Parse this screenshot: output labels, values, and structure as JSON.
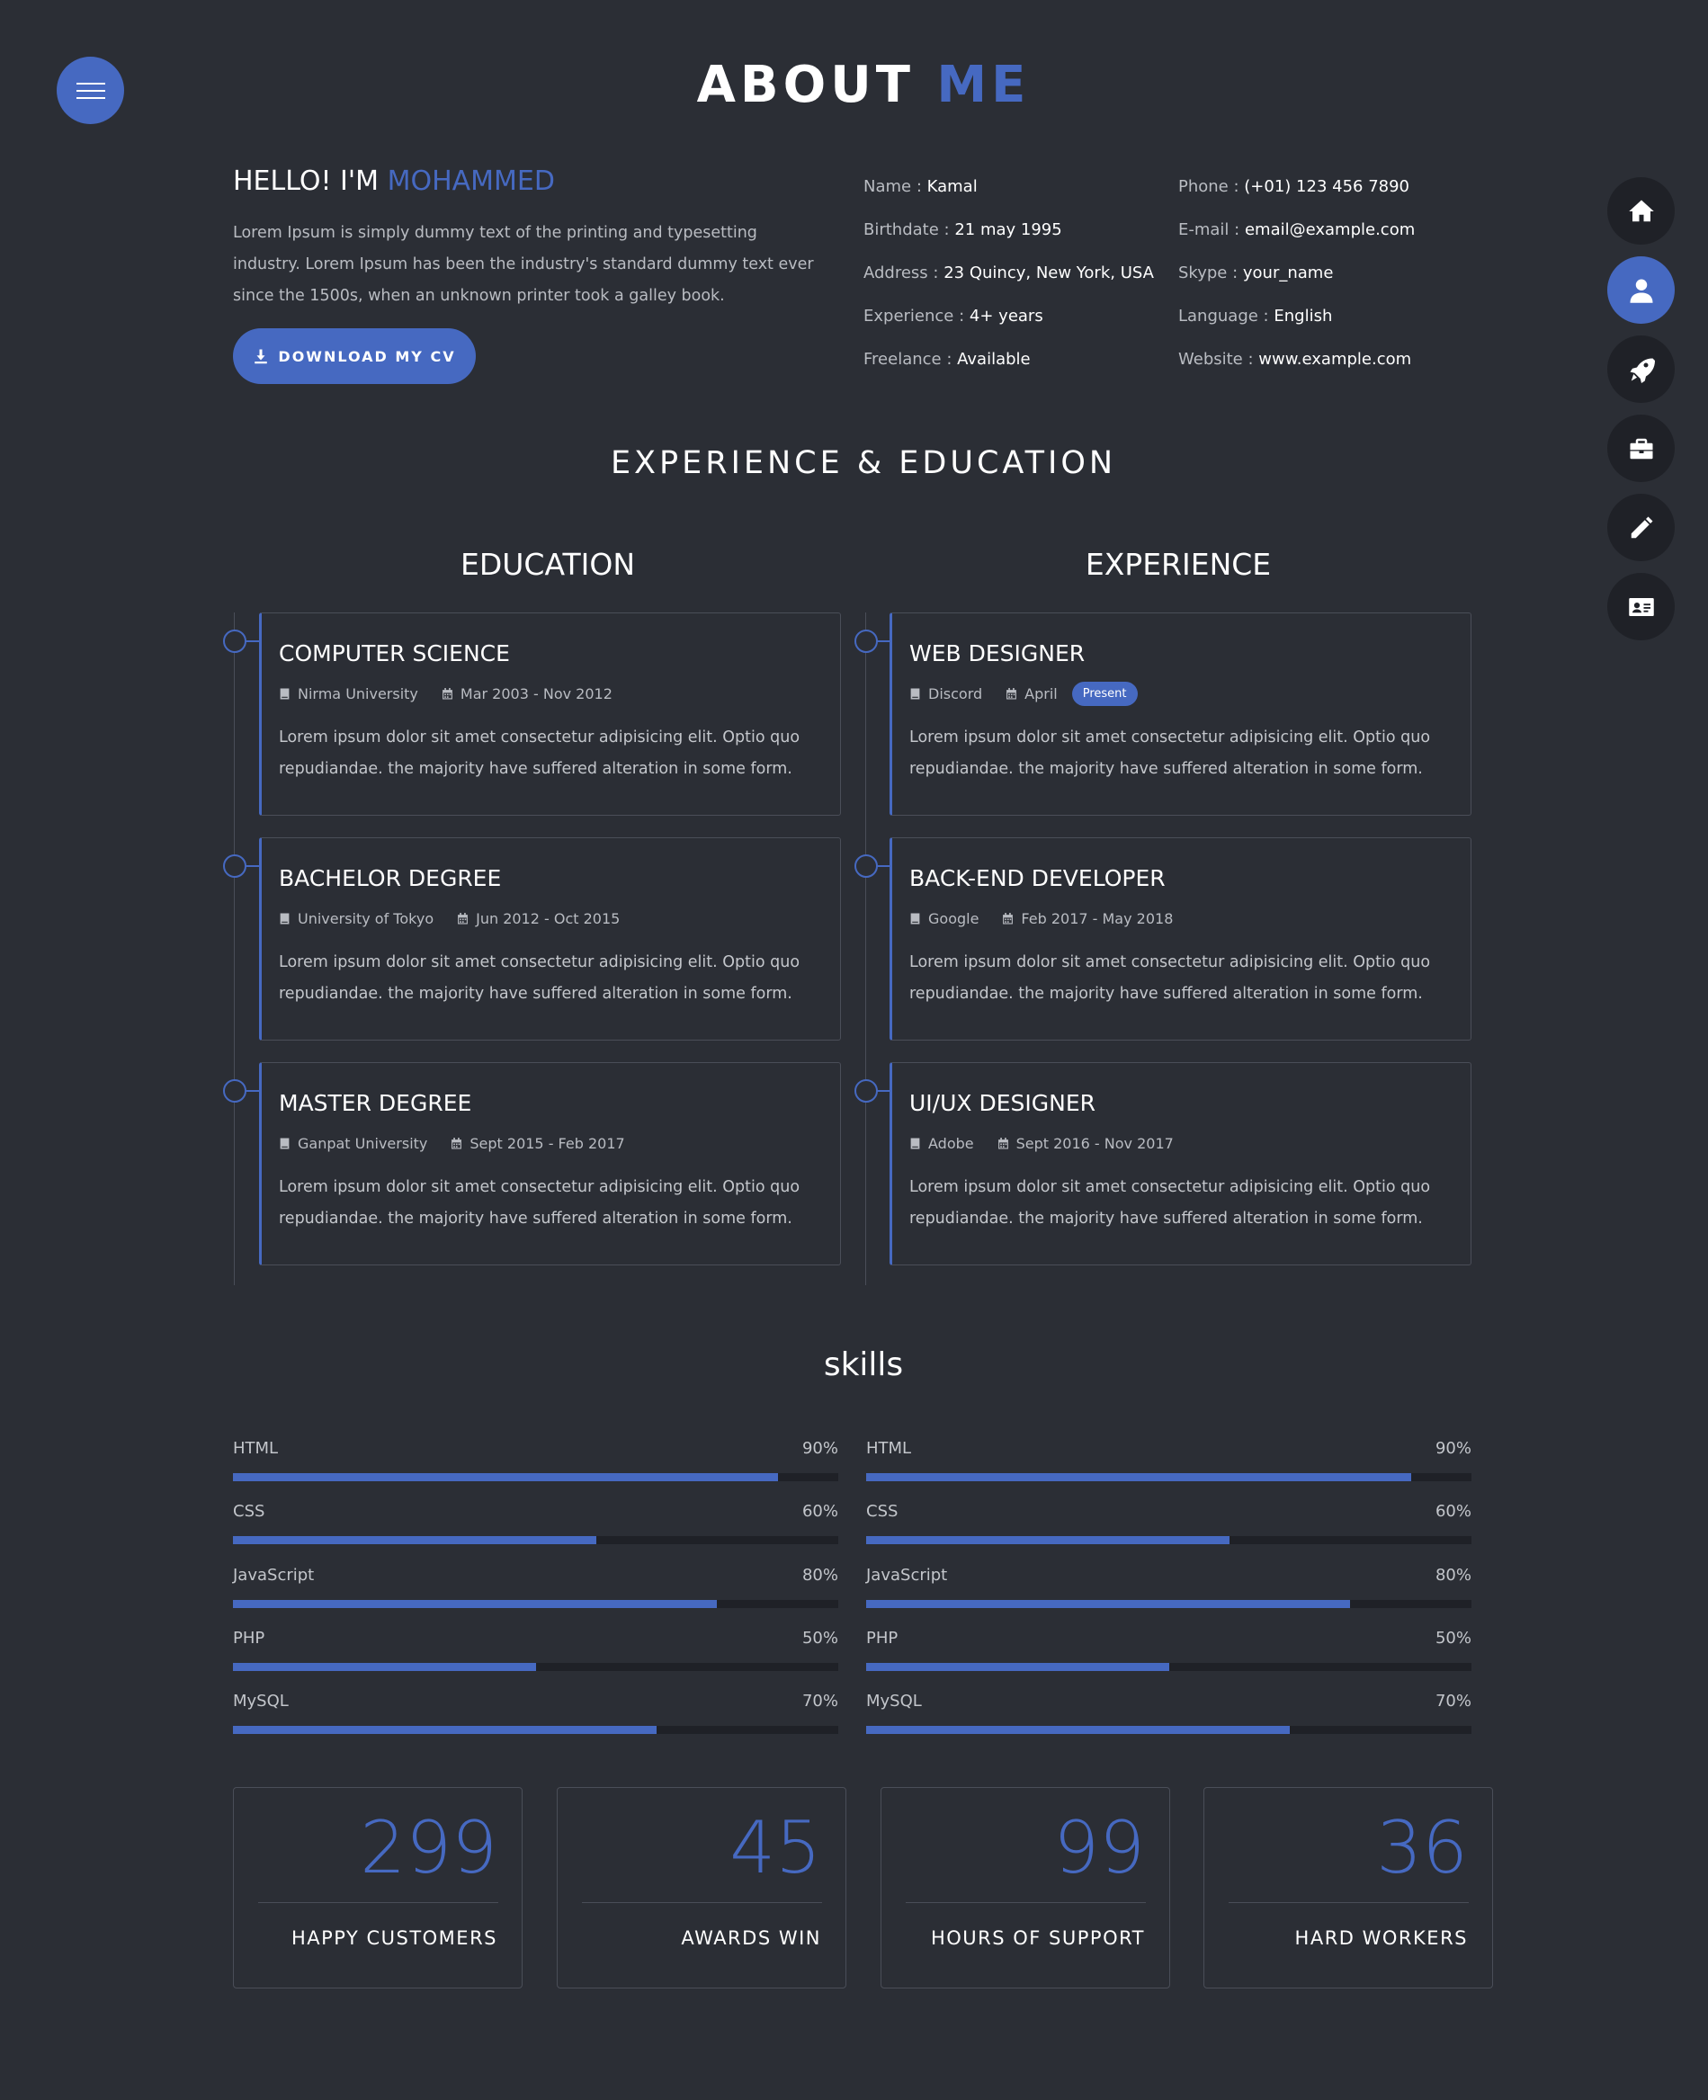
{
  "page": {
    "title_main": "ABOUT",
    "title_accent": "ME"
  },
  "nav": {
    "items": [
      {
        "icon": "home-icon",
        "active": false
      },
      {
        "icon": "user-icon",
        "active": true
      },
      {
        "icon": "rocket-icon",
        "active": false
      },
      {
        "icon": "briefcase-icon",
        "active": false
      },
      {
        "icon": "pencil-icon",
        "active": false
      },
      {
        "icon": "id-card-icon",
        "active": false
      }
    ]
  },
  "about": {
    "hello_prefix": "HELLO! I'M",
    "name_accent": "MOHAMMED",
    "intro": "Lorem Ipsum is simply dummy text of the printing and typesetting industry. Lorem Ipsum has been the industry's standard dummy text ever since the 1500s, when an unknown printer took a galley book.",
    "cv_button": "DOWNLOAD MY CV",
    "info_left": [
      {
        "label": "Name :",
        "value": "Kamal"
      },
      {
        "label": "Birthdate :",
        "value": "21 may 1995"
      },
      {
        "label": "Address :",
        "value": "23 Quincy, New York, USA"
      },
      {
        "label": "Experience :",
        "value": "4+ years"
      },
      {
        "label": "Freelance :",
        "value": "Available"
      }
    ],
    "info_right": [
      {
        "label": "Phone :",
        "value": "(+01) 123 456 7890"
      },
      {
        "label": "E-mail :",
        "value": "email@example.com"
      },
      {
        "label": "Skype :",
        "value": "your_name"
      },
      {
        "label": "Language :",
        "value": "English"
      },
      {
        "label": "Website :",
        "value": "www.example.com"
      }
    ]
  },
  "resume": {
    "section_title": "EXPERIENCE & EDUCATION",
    "education_heading": "EDUCATION",
    "experience_heading": "EXPERIENCE",
    "education": [
      {
        "title": "COMPUTER SCIENCE",
        "place": "Nirma University",
        "date": "Mar 2003 - Nov 2012",
        "badge": "",
        "text": "Lorem ipsum dolor sit amet consectetur adipisicing elit. Optio quo repudiandae. the majority have suffered alteration in some form."
      },
      {
        "title": "BACHELOR DEGREE",
        "place": "University of Tokyo",
        "date": "Jun 2012 - Oct 2015",
        "badge": "",
        "text": "Lorem ipsum dolor sit amet consectetur adipisicing elit. Optio quo repudiandae. the majority have suffered alteration in some form."
      },
      {
        "title": "MASTER DEGREE",
        "place": "Ganpat University",
        "date": "Sept 2015 - Feb 2017",
        "badge": "",
        "text": "Lorem ipsum dolor sit amet consectetur adipisicing elit. Optio quo repudiandae. the majority have suffered alteration in some form."
      }
    ],
    "experience": [
      {
        "title": "WEB DESIGNER",
        "place": "Discord",
        "date": "April",
        "badge": "Present",
        "text": "Lorem ipsum dolor sit amet consectetur adipisicing elit. Optio quo repudiandae. the majority have suffered alteration in some form."
      },
      {
        "title": "BACK-END DEVELOPER",
        "place": "Google",
        "date": "Feb 2017 - May 2018",
        "badge": "",
        "text": "Lorem ipsum dolor sit amet consectetur adipisicing elit. Optio quo repudiandae. the majority have suffered alteration in some form."
      },
      {
        "title": "UI/UX DESIGNER",
        "place": "Adobe",
        "date": "Sept 2016 - Nov 2017",
        "badge": "",
        "text": "Lorem ipsum dolor sit amet consectetur adipisicing elit. Optio quo repudiandae. the majority have suffered alteration in some form."
      }
    ]
  },
  "skills": {
    "title": "skills",
    "left": [
      {
        "name": "HTML",
        "percent_label": "90%",
        "value": 90
      },
      {
        "name": "CSS",
        "percent_label": "60%",
        "value": 60
      },
      {
        "name": "JavaScript",
        "percent_label": "80%",
        "value": 80
      },
      {
        "name": "PHP",
        "percent_label": "50%",
        "value": 50
      },
      {
        "name": "MySQL",
        "percent_label": "70%",
        "value": 70
      }
    ],
    "right": [
      {
        "name": "HTML",
        "percent_label": "90%",
        "value": 90
      },
      {
        "name": "CSS",
        "percent_label": "60%",
        "value": 60
      },
      {
        "name": "JavaScript",
        "percent_label": "80%",
        "value": 80
      },
      {
        "name": "PHP",
        "percent_label": "50%",
        "value": 50
      },
      {
        "name": "MySQL",
        "percent_label": "70%",
        "value": 70
      }
    ]
  },
  "counters": [
    {
      "number": "299",
      "label": "HAPPY CUSTOMERS"
    },
    {
      "number": "45",
      "label": "AWARDS WIN"
    },
    {
      "number": "99",
      "label": "HOURS OF SUPPORT"
    },
    {
      "number": "36",
      "label": "HARD WORKERS"
    }
  ],
  "colors": {
    "background": "#2b2e35",
    "accent": "#4669c1",
    "dark_circle": "#1f2127"
  }
}
